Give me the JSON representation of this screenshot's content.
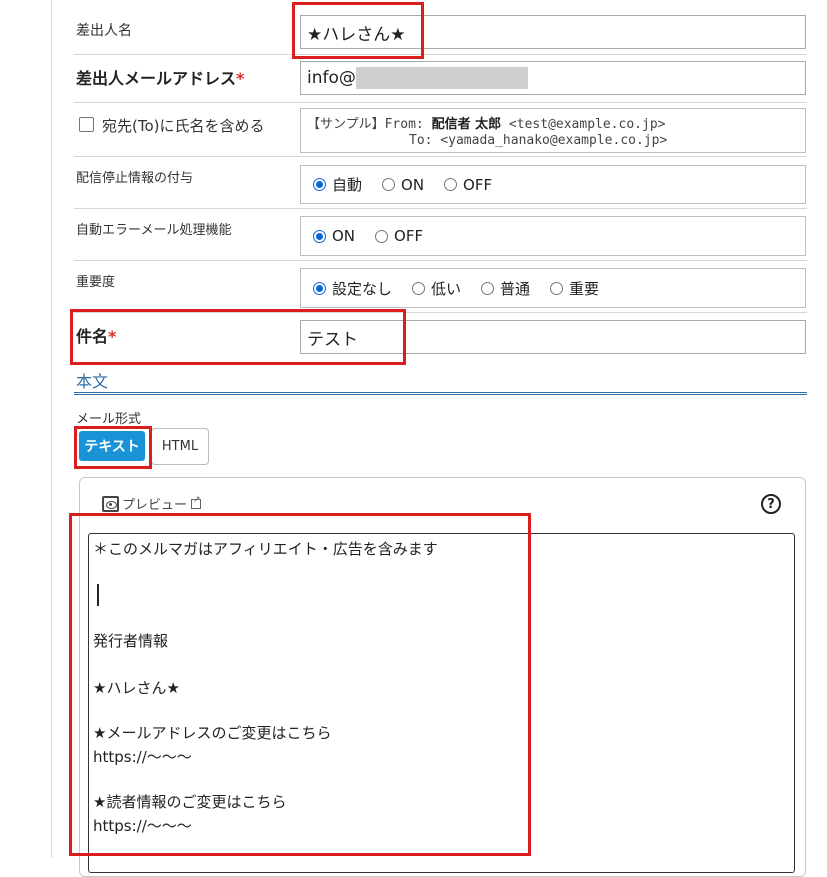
{
  "sender_name": {
    "label": "差出人名",
    "value": "★ハレさん★"
  },
  "sender_email": {
    "label": "差出人メールアドレス",
    "required_mark": "*",
    "value": "info@"
  },
  "include_name": {
    "label": "宛先(To)に氏名を含める",
    "sample_prefix": "【サンプル】From: ",
    "sample_name": "配信者 太郎",
    "sample_from_addr": " <test@example.co.jp>",
    "sample_to": "To: <yamada_hanako@example.co.jp>"
  },
  "unsubscribe": {
    "label": "配信停止情報の付与",
    "options": [
      "自動",
      "ON",
      "OFF"
    ],
    "selected": "自動"
  },
  "auto_error": {
    "label": "自動エラーメール処理機能",
    "options": [
      "ON",
      "OFF"
    ],
    "selected": "ON"
  },
  "importance": {
    "label": "重要度",
    "options": [
      "設定なし",
      "低い",
      "普通",
      "重要"
    ],
    "selected": "設定なし"
  },
  "subject": {
    "label": "件名",
    "required_mark": "*",
    "value": "テスト"
  },
  "body_section": {
    "title": "本文"
  },
  "mail_format": {
    "label": "メール形式",
    "text_button": "テキスト",
    "html_button": "HTML",
    "selected": "テキスト"
  },
  "editor": {
    "preview_label": "プレビュー",
    "help": "?",
    "lines": [
      "＊このメルマガはアフィリエイト・広告を含みます",
      "発行者情報",
      "★ハレさん★",
      "★メールアドレスのご変更はこちら",
      "https://～～～",
      "★読者情報のご変更はこちら",
      "https://～～～"
    ]
  },
  "colors": {
    "accent": "#1992d6",
    "highlight": "#d91e1e",
    "section": "#2e6fa8",
    "required": "#d9302c"
  },
  "icons": [
    "eye-icon",
    "external-link-icon",
    "help-icon"
  ]
}
